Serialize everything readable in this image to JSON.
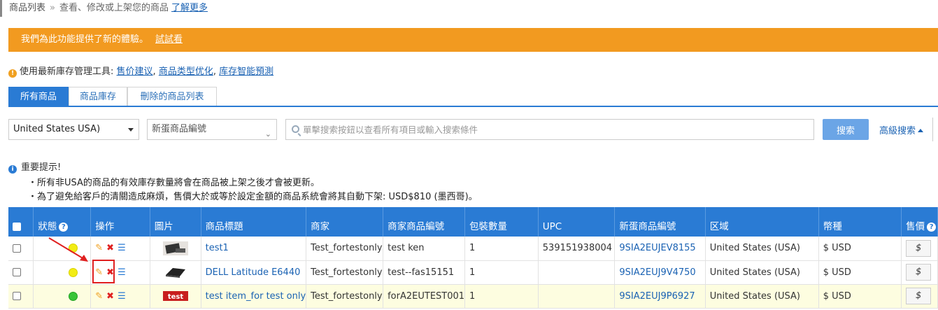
{
  "breadcrumb": {
    "root": "商品列表",
    "separator": "»",
    "desc": "查看、修改或上架您的商品",
    "learn_more": "了解更多"
  },
  "banner": {
    "text": "我們為此功能提供了新的體驗。",
    "link": "試試看"
  },
  "tools": {
    "prefix": "使用最新庫存管理工具:",
    "links": [
      "售价建议",
      "商品类型优化",
      "库存智能預測"
    ]
  },
  "tabs": [
    {
      "label": "所有商品",
      "active": true
    },
    {
      "label": "商品庫存",
      "active": false
    },
    {
      "label": "刪除的商品列表",
      "active": false
    }
  ],
  "filters": {
    "country": "United States USA)",
    "search_field": "新蛋商品編號",
    "search_placeholder": "單擊搜索按鈕以查看所有項目或輸入搜索條件",
    "search_button": "搜索",
    "advanced": "高級搜索"
  },
  "notice": {
    "title": "重要提示!",
    "lines": [
      "・所有非USA的商品的有效庫存數量將會在商品被上架之後才會被更新。",
      "・為了避免給客戶的清關造成麻煩，售價大於或等於設定金額的商品系統會將其自動下架: USD$810 (墨西哥)。"
    ]
  },
  "table": {
    "headers": [
      "",
      "狀態",
      "操作",
      "圖片",
      "商品標題",
      "商家",
      "商家商品編號",
      "包裝數量",
      "UPC",
      "新蛋商品編號",
      "区域",
      "幣種",
      "售價"
    ],
    "rows": [
      {
        "status": "yellow",
        "title": "test1",
        "seller": "Test_fortestonly",
        "seller_sku": "test ken",
        "pack": "1",
        "upc": "539151938004",
        "item_no": "9SIA2EUJEV8155",
        "region": "United States (USA)",
        "currency": "$ USD",
        "highlight": false
      },
      {
        "status": "yellow",
        "title": "DELL Latitude E6440",
        "seller": "Test_fortestonly",
        "seller_sku": "test--fas15151",
        "pack": "1",
        "upc": "",
        "item_no": "9SIA2EUJ9V4750",
        "region": "United States (USA)",
        "currency": "$ USD",
        "highlight": false
      },
      {
        "status": "green",
        "title": "test item_for test only",
        "seller": "Test_fortestonly",
        "seller_sku": "forA2EUTEST001",
        "pack": "1",
        "upc": "",
        "item_no": "9SIA2EUJ9P6927",
        "region": "United States (USA)",
        "currency": "$ USD",
        "highlight": true
      }
    ],
    "price_btn": "$"
  },
  "icons": {
    "warning": "warning-icon",
    "info": "info-icon",
    "help": "help-icon",
    "edit": "edit-icon",
    "delete": "delete-icon",
    "list": "list-icon"
  }
}
